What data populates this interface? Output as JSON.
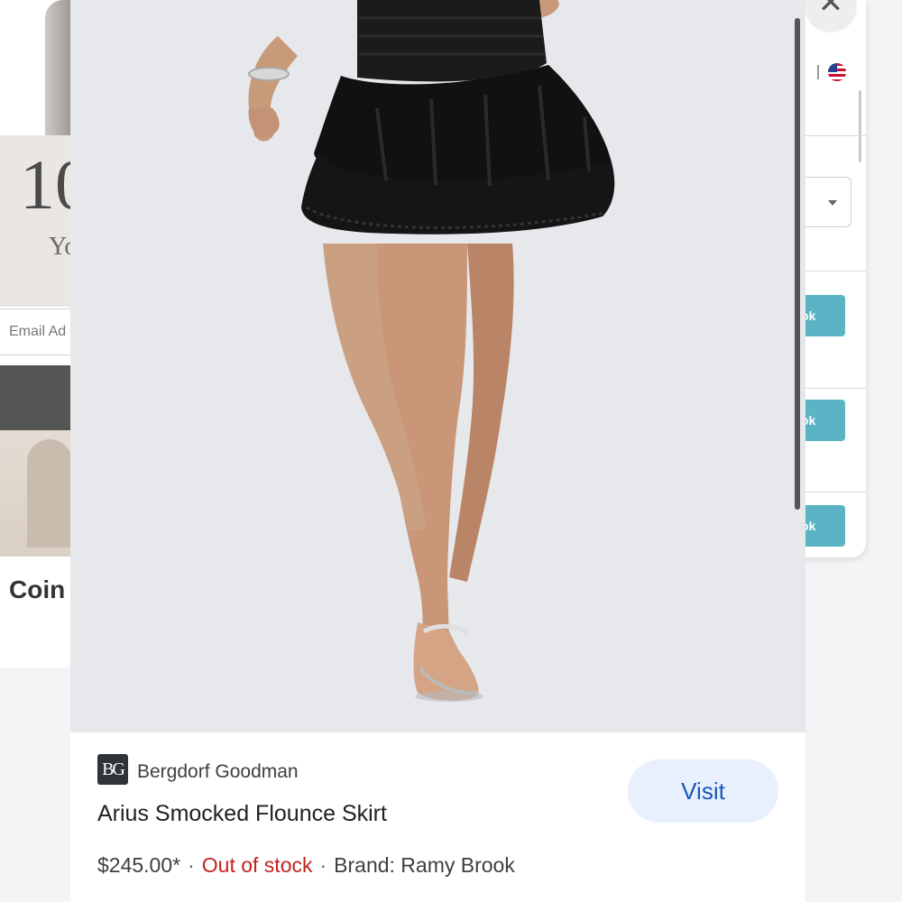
{
  "background_left": {
    "hero_number": "10",
    "hero_subtext": "Yo",
    "email_placeholder": "Email Ad",
    "coin_label": "Coin"
  },
  "background_right": {
    "close_glyph": "✕",
    "button_label_1": "ok",
    "button_label_2": "ok",
    "button_label_3": "ok"
  },
  "product": {
    "store": "Bergdorf Goodman",
    "store_logo_text": "BG",
    "title": "Arius Smocked Flounce Skirt",
    "price": "$245.00*",
    "availability": "Out of stock",
    "brand": "Brand: Ramy Brook",
    "separator": "·",
    "visit_label": "Visit",
    "image_subject": "black smocked tiered flounce mini skirt with embellished thong sandals"
  },
  "colors": {
    "accent_link": "#1a57b8",
    "visit_bg": "#e8f0fe",
    "out_of_stock": "#c5221f",
    "teal_button": "#5bb4c5"
  }
}
